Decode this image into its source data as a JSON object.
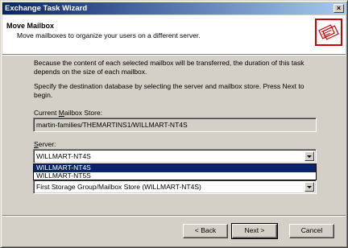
{
  "window": {
    "title": "Exchange Task Wizard",
    "close_label": "×"
  },
  "header": {
    "title": "Move Mailbox",
    "subtitle": "Move mailboxes to organize your users on a different server."
  },
  "body": {
    "paragraph1": "Because the content of each selected mailbox will be transferred, the duration of this task depends on the size of each mailbox.",
    "paragraph2": "Specify the destination database by selecting the server and mailbox store. Press Next to begin.",
    "current_store_label": "Current Mailbox Store:",
    "current_store_value": "martin-families/THEMARTINS1/WILLMART-NT4S",
    "server_label": "Server:",
    "server_value": "WILLMART-NT4S",
    "server_options": [
      "WILLMART-NT4S",
      "WILLMART-NT5S"
    ],
    "mailbox_store_value": "First Storage Group/Mailbox Store (WILLMART-NT4S)"
  },
  "footer": {
    "back_label": "< Back",
    "next_label": "Next >",
    "cancel_label": "Cancel"
  }
}
